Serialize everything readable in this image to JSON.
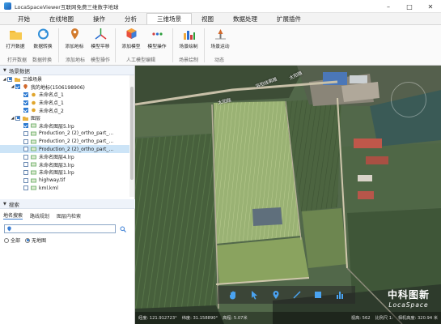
{
  "window": {
    "title": "LocaSpaceViewer互联网免费三维数字地球"
  },
  "menu": [
    "开始",
    "在线地图",
    "操作",
    "分析",
    "三维场景",
    "视图",
    "数据处理",
    "扩展插件"
  ],
  "menu_active_index": 4,
  "ribbon": {
    "buttons": [
      "打开数据",
      "数据转换",
      "添加地标",
      "模型平移",
      "添加模型",
      "模型操作",
      "场景绘制",
      "场景运动"
    ],
    "groups": [
      "打开数据",
      "数据转换",
      "添加地标",
      "模型操作",
      "人工模型编辑",
      "场景绘制",
      "动态"
    ]
  },
  "layer_panel": {
    "title": "场景数据",
    "tree": [
      {
        "label": "三维场景",
        "level": 0,
        "expand": "minus",
        "check": "part",
        "icon": "folder"
      },
      {
        "label": "我的地标(1506198906)",
        "level": 1,
        "expand": "minus",
        "check": "on",
        "icon": "placemark"
      },
      {
        "label": "未命名点_1",
        "level": 2,
        "expand": "",
        "check": "on",
        "icon": "point"
      },
      {
        "label": "未命名点_1",
        "level": 2,
        "expand": "",
        "check": "on",
        "icon": "point"
      },
      {
        "label": "未命名点_2",
        "level": 2,
        "expand": "",
        "check": "on",
        "icon": "point"
      },
      {
        "label": "图层",
        "level": 1,
        "expand": "minus",
        "check": "part",
        "icon": "folder"
      },
      {
        "label": "未命名图层5.lrp",
        "level": 2,
        "expand": "",
        "check": "on",
        "icon": "image"
      },
      {
        "label": "Production_2 (2)_ortho_part_...",
        "level": 2,
        "expand": "",
        "check": "",
        "icon": "image"
      },
      {
        "label": "Production_2 (2)_ortho_part_...",
        "level": 2,
        "expand": "",
        "check": "",
        "icon": "image"
      },
      {
        "label": "Production_2 (2)_ortho_part_...",
        "level": 2,
        "expand": "",
        "check": "",
        "icon": "image",
        "selected": true
      },
      {
        "label": "未命名图层4.lrp",
        "level": 2,
        "expand": "",
        "check": "",
        "icon": "image"
      },
      {
        "label": "未命名图层3.lrp",
        "level": 2,
        "expand": "",
        "check": "",
        "icon": "image"
      },
      {
        "label": "未命名图层1.lrp",
        "level": 2,
        "expand": "",
        "check": "",
        "icon": "image"
      },
      {
        "label": "highway.tif",
        "level": 2,
        "expand": "",
        "check": "",
        "icon": "image"
      },
      {
        "label": "kml.kml",
        "level": 2,
        "expand": "",
        "check": "",
        "icon": "image"
      }
    ]
  },
  "search_panel": {
    "title": "搜索",
    "tabs": [
      "地名搜索",
      "路线规划",
      "图层内检索"
    ],
    "input_value": "",
    "radio_options": [
      "全部",
      "无地图"
    ],
    "radio_selected": 1
  },
  "map": {
    "road_labels": [
      "洛阳线南路",
      "太阳路",
      "太阳路"
    ],
    "watermark_cn": "中科图新",
    "watermark_en": "LocaSpace",
    "status": {
      "longitude": "经度: 121.912723°",
      "latitude": "纬度: 31.158890°",
      "altitude": "高程: 5.07米",
      "visible": "视高: 562",
      "scale": "比例尺 1:",
      "eye_altitude": "相机高度: 320.94 米"
    }
  },
  "map_tools": [
    "hand-icon",
    "cursor-icon",
    "pin-icon",
    "line-icon",
    "rectangle-icon",
    "chart-icon"
  ]
}
